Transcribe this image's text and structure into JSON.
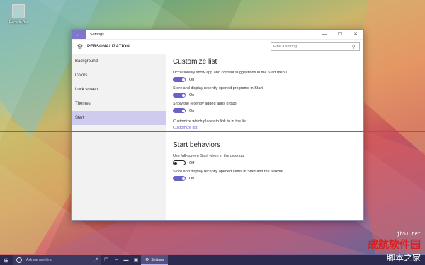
{
  "desktop": {
    "icon_label": "Recycle Bin"
  },
  "window": {
    "title": "Settings",
    "back_glyph": "←",
    "controls": {
      "minimize": "—",
      "maximize": "☐",
      "close": "✕"
    }
  },
  "header": {
    "title": "PERSONALIZATION",
    "search_placeholder": "Find a setting"
  },
  "sidebar": {
    "items": [
      {
        "label": "Background"
      },
      {
        "label": "Colors"
      },
      {
        "label": "Lock screen"
      },
      {
        "label": "Themes"
      },
      {
        "label": "Start"
      }
    ],
    "active": "Start"
  },
  "content": {
    "section1": {
      "title": "Customize list",
      "s1": {
        "desc": "Occasionally show app and content suggestions in the Start menu",
        "state": "On"
      },
      "s2": {
        "desc": "Store and display recently opened programs in Start",
        "state": "On"
      },
      "s3": {
        "desc": "Show the recently added apps group",
        "state": "On"
      },
      "s4": {
        "desc": "Customize which places to link to in the list",
        "link": "Customize list"
      }
    },
    "section2": {
      "title": "Start behaviors",
      "s1": {
        "desc": "Use full-screen Start when in the desktop",
        "state": "Off"
      },
      "s2": {
        "desc": "Store and display recently opened items in Start and the taskbar",
        "state": "On"
      }
    }
  },
  "taskbar": {
    "search_placeholder": "Ask me anything",
    "active_app": "Settings"
  },
  "watermark": {
    "line1": "jb51.net",
    "line2": "成航软件园",
    "line3": "脚本之家"
  },
  "colors": {
    "accent": "#6a62c7",
    "nav_active": "#cfcbee",
    "taskbar": "#2d2a4f",
    "red_line": "#e23b3b"
  }
}
